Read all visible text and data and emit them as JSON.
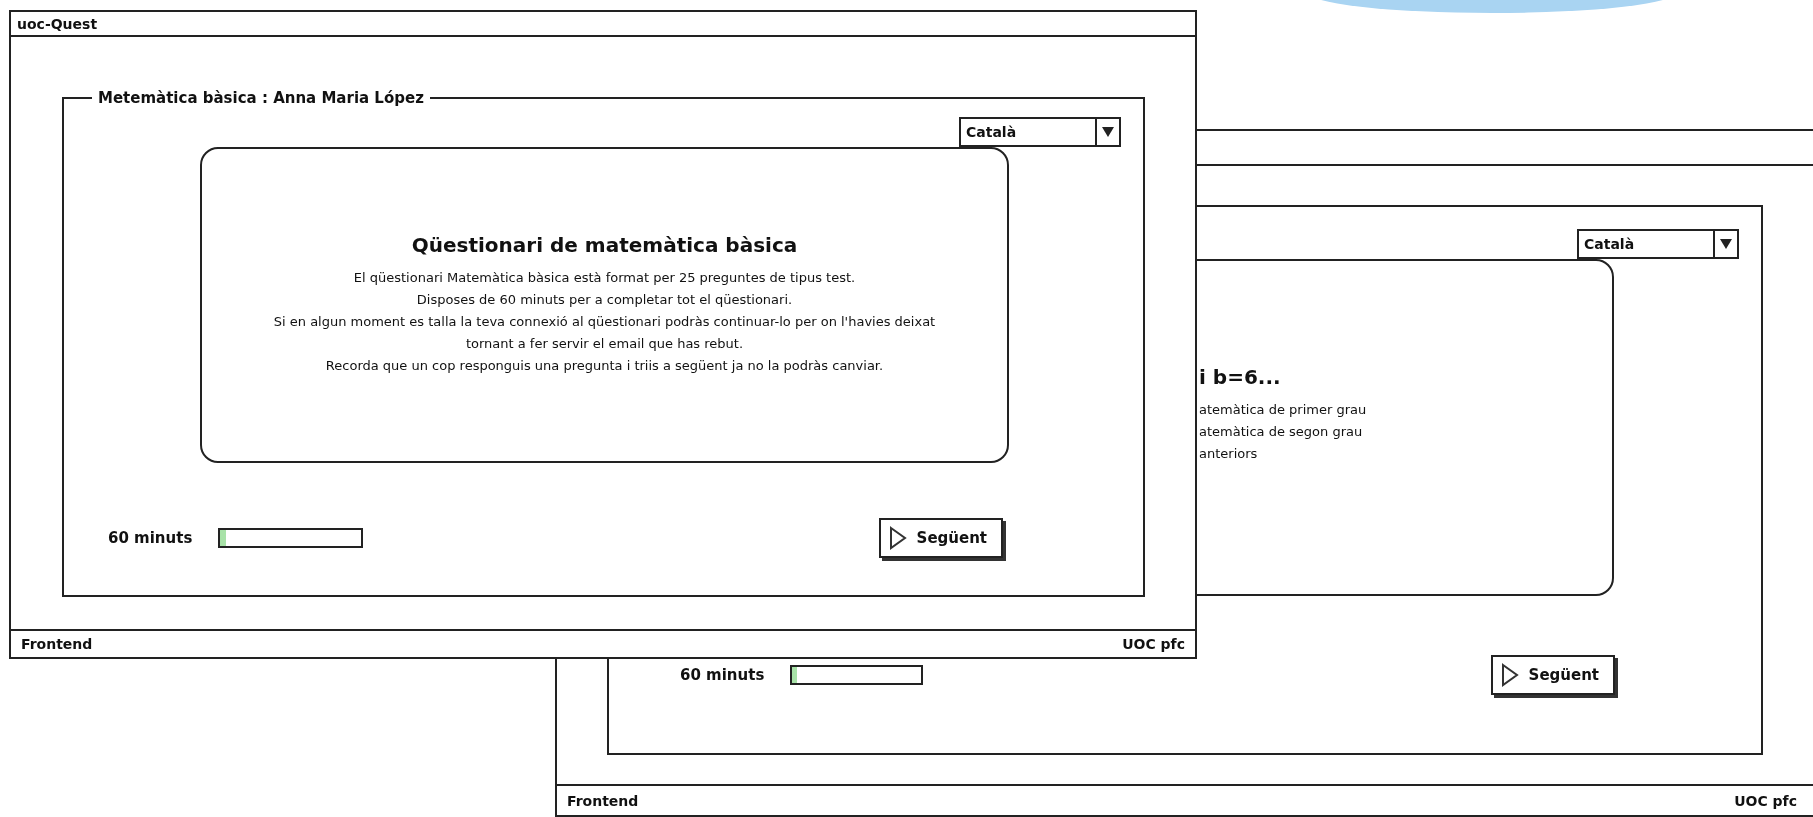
{
  "windows": [
    {
      "kind": "background",
      "language": "Català",
      "card": {
        "heading": "i b=6...",
        "lines": [
          "atemàtica de primer grau",
          "atemàtica de segon grau",
          "anteriors"
        ]
      },
      "timer": {
        "label": "60 minuts",
        "level": 0.04
      },
      "next_button": "Següent",
      "status_bar": {
        "left": "Frontend",
        "right": "UOC pfc"
      }
    },
    {
      "kind": "foreground",
      "title": "uoc-Quest",
      "legend": "Metemàtica bàsica : Anna Maria López",
      "language": "Català",
      "card": {
        "heading": "Qüestionari de matemàtica bàsica",
        "lines": [
          "El qüestionari Matemàtica bàsica està format per 25 preguntes de tipus test.",
          "Disposes de 60 minuts per a completar tot el qüestionari.",
          "Si en algun moment es talla la teva connexió al qüestionari podràs continuar-lo per on l'havies deixat",
          "tornant a fer servir el email que has rebut.",
          "Recorda que un cop responguis una pregunta i triis a següent ja no la podràs canviar."
        ]
      },
      "timer": {
        "label": "60 minuts",
        "level": 0.04
      },
      "next_button": "Següent",
      "status_bar": {
        "left": "Frontend",
        "right": "UOC pfc"
      }
    }
  ]
}
